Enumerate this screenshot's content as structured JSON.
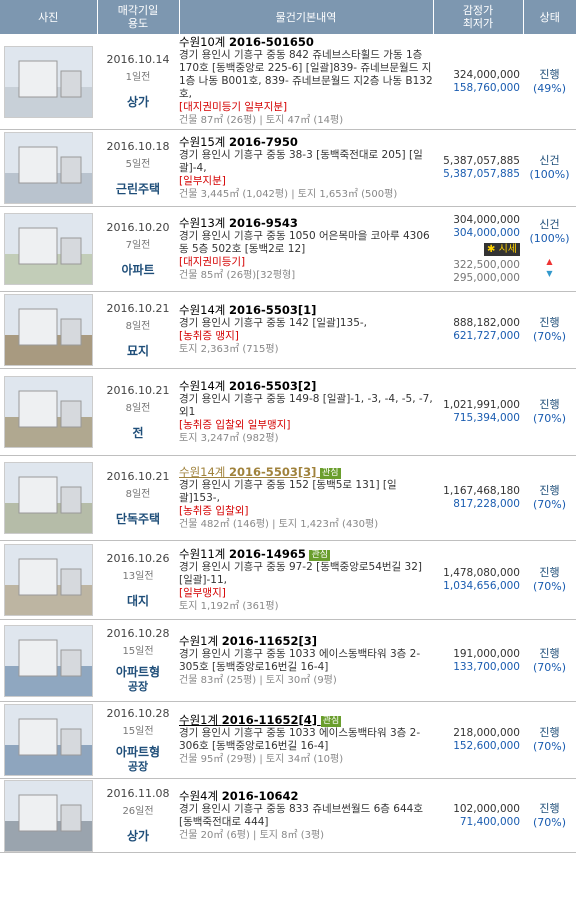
{
  "header": {
    "photo": "사진",
    "date1": "매각기일",
    "date2": "용도",
    "info": "물건기본내역",
    "price1": "감정가",
    "price2": "최저가",
    "status": "상태"
  },
  "rows": [
    {
      "date": "2016.10.14",
      "ago": "1일전",
      "use": "상가",
      "use_sub": "",
      "court": "수원10계",
      "case_no": "2016-501650",
      "badge": "",
      "addr": "경기 용인시 기흥구 중동 842 쥬네브스타휠드 가동 1층 170호 [동백중앙로 225-6] [일괄]839-  쥬네브문월드 지1층 나동 B001호, 839- 쥬네브문월드 지2층 나동 B132호,",
      "tags": "[대지권미등기  일부지분]",
      "area": "건물 87㎡ (26평) | 토지 47㎡ (14평)",
      "appraise": "324,000,000",
      "minimum": "158,760,000",
      "status": "진행",
      "pct": "(49%)",
      "photo": "#c8d0d8"
    },
    {
      "date": "2016.10.18",
      "ago": "5일전",
      "use": "근린주택",
      "use_sub": "",
      "court": "수원15계",
      "case_no": "2016-7950",
      "badge": "",
      "addr": "경기 용인시 기흥구 중동 38-3 [동백죽전대로 205] [일괄]-4,",
      "tags": "[일부지분]",
      "area": "건물 3,445㎡ (1,042평) | 토지 1,653㎡ (500평)",
      "appraise": "5,387,057,885",
      "minimum": "5,387,057,885",
      "status": "신건",
      "pct": "(100%)",
      "photo": "#b9c3ce"
    },
    {
      "date": "2016.10.20",
      "ago": "7일전",
      "use": "아파트",
      "use_sub": "",
      "court": "수원13계",
      "case_no": "2016-9543",
      "badge": "",
      "addr": "경기 용인시 기흥구 중동 1050 어은목마을 코아루 4306동 5층 502호 [동백2로 12]",
      "tags": "[대지권미등기]",
      "area": "건물 85㎡ (26평)[32평형]",
      "appraise": "304,000,000",
      "minimum": "304,000,000",
      "market_label": "시세",
      "market_high": "322,500,000",
      "market_low": "295,000,000",
      "status": "신건",
      "pct": "(100%)",
      "photo": "#c2cdb8"
    },
    {
      "date": "2016.10.21",
      "ago": "8일전",
      "use": "묘지",
      "use_sub": "",
      "court": "수원14계",
      "case_no": "2016-5503[1]",
      "badge": "",
      "addr": "경기 용인시 기흥구 중동 142 [일괄]135-,",
      "tags": "[농취증  맹지]",
      "area": "토지 2,363㎡ (715평)",
      "appraise": "888,182,000",
      "minimum": "621,727,000",
      "status": "진행",
      "pct": "(70%)",
      "photo": "#a89a80"
    },
    {
      "date": "2016.10.21",
      "ago": "8일전",
      "use": "전",
      "use_sub": "",
      "court": "수원14계",
      "case_no": "2016-5503[2]",
      "badge": "",
      "addr": "경기 용인시 기흥구 중동 149-8 [일괄]-1, -3, -4, -5, -7, 외1",
      "tags": "[농취증  입찰외  일부맹지]",
      "area": "토지 3,247㎡ (982평)",
      "appraise": "1,021,991,000",
      "minimum": "715,394,000",
      "status": "진행",
      "pct": "(70%)",
      "photo": "#b0a890"
    },
    {
      "date": "2016.10.21",
      "ago": "8일전",
      "use": "단독주택",
      "use_sub": "",
      "court": "수원14계",
      "case_no": "2016-5503[3]",
      "badge": "관심",
      "addr": "경기 용인시 기흥구 중동 152 [동백5로 131] [일괄]153-,",
      "tags": "[농취증  입찰외]",
      "area": "건물 482㎡ (146평) | 토지 1,423㎡ (430평)",
      "appraise": "1,167,468,180",
      "minimum": "817,228,000",
      "status": "진행",
      "pct": "(70%)",
      "photo": "#b5bca8"
    },
    {
      "date": "2016.10.26",
      "ago": "13일전",
      "use": "대지",
      "use_sub": "",
      "court": "수원11계",
      "case_no": "2016-14965",
      "badge": "관심",
      "addr": "경기 용인시 기흥구 중동 97-2 [동백중앙로54번길 32] [일괄]-11,",
      "tags": "[일부맹지]",
      "area": "토지 1,192㎡ (361평)",
      "appraise": "1,478,080,000",
      "minimum": "1,034,656,000",
      "status": "진행",
      "pct": "(70%)",
      "photo": "#bdb5a2"
    },
    {
      "date": "2016.10.28",
      "ago": "15일전",
      "use": "아파트형",
      "use_sub": "공장",
      "court": "수원1계",
      "case_no": "2016-11652[3]",
      "badge": "",
      "addr": "경기 용인시 기흥구 중동 1033 에이스동백타워 3층 2-305호 [동백중앙로16번길 16-4]",
      "tags": "",
      "area": "건물 83㎡ (25평) | 토지 30㎡ (9평)",
      "appraise": "191,000,000",
      "minimum": "133,700,000",
      "status": "진행",
      "pct": "(70%)",
      "photo": "#8fa7c0"
    },
    {
      "date": "2016.10.28",
      "ago": "15일전",
      "use": "아파트형",
      "use_sub": "공장",
      "court": "수원1계",
      "case_no": "2016-11652[4]",
      "badge": "관심",
      "addr": "경기 용인시 기흥구 중동 1033 에이스동백타워 3층 2-306호 [동백중앙로16번길 16-4]",
      "tags": "",
      "area": "건물 95㎡ (29평) | 토지 34㎡ (10평)",
      "appraise": "218,000,000",
      "minimum": "152,600,000",
      "status": "진행",
      "pct": "(70%)",
      "photo": "#8ea5be"
    },
    {
      "date": "2016.11.08",
      "ago": "26일전",
      "use": "상가",
      "use_sub": "",
      "court": "수원4계",
      "case_no": "2016-10642",
      "badge": "",
      "addr": "경기 용인시 기흥구 중동 833 쥬네브썬월드 6층 644호 [동백죽전대로 444]",
      "tags": "",
      "area": "건물 20㎡ (6평) | 토지 8㎡ (3평)",
      "appraise": "102,000,000",
      "minimum": "71,400,000",
      "status": "진행",
      "pct": "(70%)",
      "photo": "#9aa4ae"
    }
  ],
  "colors": {
    "header_bg": "#7d97b0",
    "minimum": "#1a5cb0",
    "use": "#1f4e79",
    "tag": "#d40000"
  }
}
